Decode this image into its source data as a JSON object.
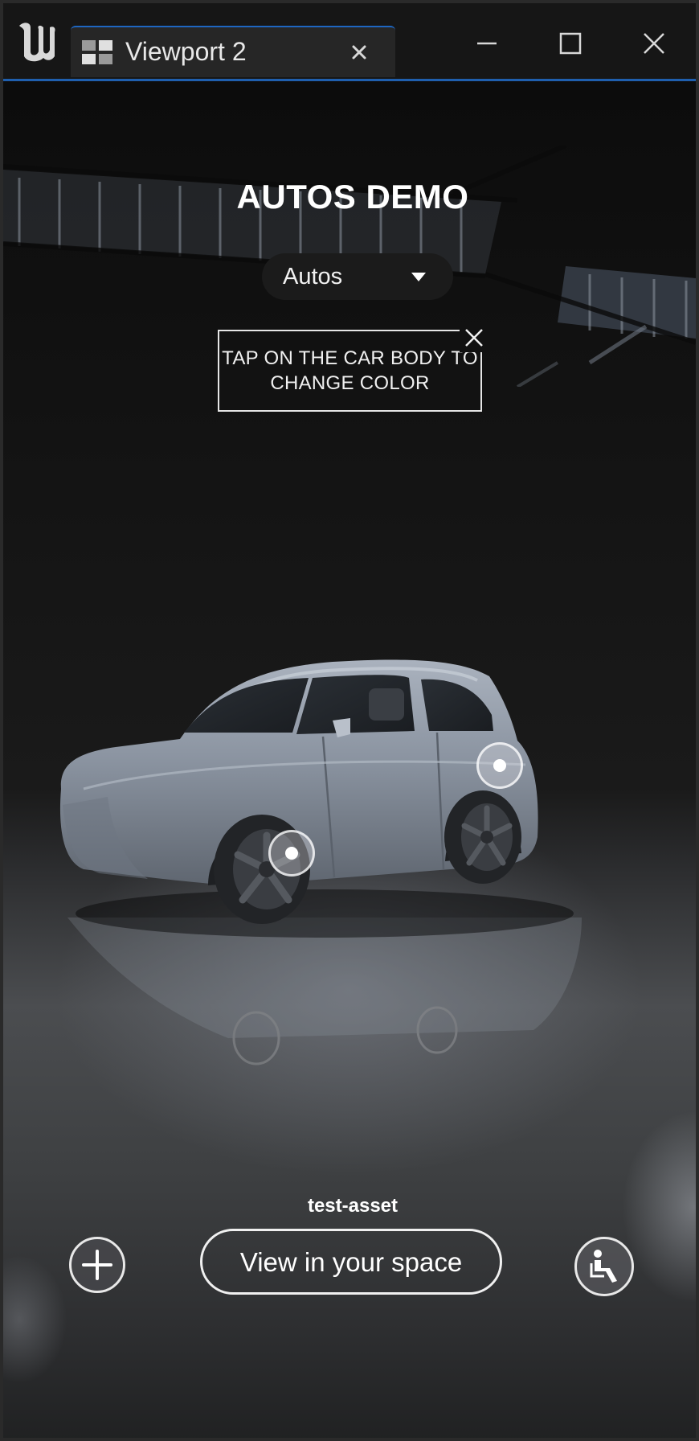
{
  "window": {
    "tab_title": "Viewport 2",
    "controls": [
      "minimize",
      "maximize",
      "close"
    ]
  },
  "scene": {
    "title": "AUTOS DEMO",
    "dropdown": {
      "selected": "Autos"
    },
    "hint": {
      "text_line1": "TAP ON THE CAR BODY TO",
      "text_line2": "CHANGE COLOR"
    },
    "asset_name": "test-asset",
    "view_button_label": "View in your space"
  },
  "colors": {
    "accent": "#1f5fae",
    "car_body": "#8a93a0",
    "text": "#ffffff"
  },
  "icons": {
    "app_logo": "unreal-engine-logo-icon",
    "tab": "viewport-layout-icon",
    "add": "plus-icon",
    "seat": "seat-interior-icon"
  }
}
